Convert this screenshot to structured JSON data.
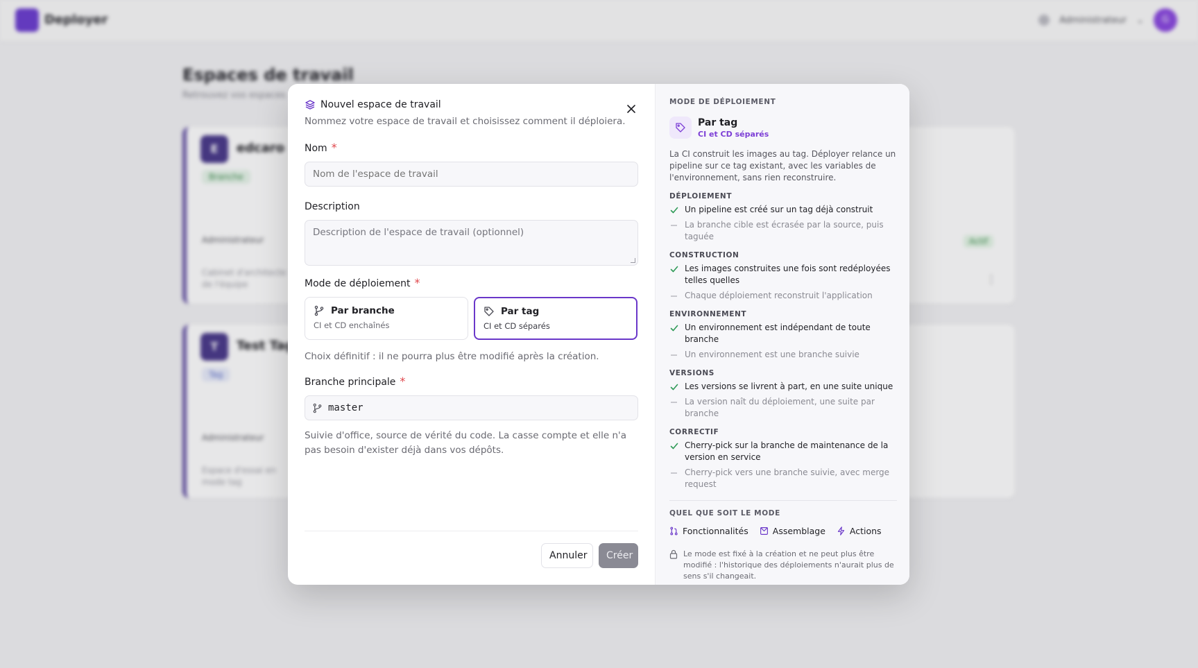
{
  "app": {
    "brand": "Deployer",
    "user_name": "Administrateur",
    "avatar_initial": "G"
  },
  "background": {
    "title": "Espaces de travail",
    "subtitle": "Retrouvez vos espaces",
    "cards": [
      {
        "initial": "E",
        "name": "edcaro",
        "chip": "Branche",
        "owner": "Administrateur",
        "desc": "Cabinet d'architecte de l'équipe",
        "status": "Actif"
      },
      {
        "initial": "T",
        "name": "Test Tag",
        "chip": "Tag",
        "owner": "Administrateur",
        "desc": "Espace d'essai en mode tag"
      }
    ]
  },
  "modal": {
    "title": "Nouvel espace de travail",
    "subtitle": "Nommez votre espace de travail et choisissez comment il déploiera.",
    "name_label": "Nom",
    "name_placeholder": "Nom de l'espace de travail",
    "name_value": "",
    "description_label": "Description",
    "description_placeholder": "Description de l'espace de travail (optionnel)",
    "description_value": "",
    "mode_label": "Mode de déploiement",
    "modes": [
      {
        "label": "Par branche",
        "sub": "CI et CD enchaînés",
        "selected": false,
        "icon": "git-branch-icon"
      },
      {
        "label": "Par tag",
        "sub": "CI et CD séparés",
        "selected": true,
        "icon": "tag-icon"
      }
    ],
    "mode_hint": "Choix définitif : il ne pourra plus être modifié après la création.",
    "branch_label": "Branche principale",
    "branch_value": "master",
    "branch_hint": "Suivie d'office, source de vérité du code. La casse compte et elle n'a pas besoin d'exister déjà dans vos dépôts.",
    "cancel_label": "Annuler",
    "create_label": "Créer",
    "required_mark": "*"
  },
  "panel": {
    "heading": "MODE DE DÉPLOIEMENT",
    "mode_name": "Par tag",
    "mode_sub": "CI et CD séparés",
    "description": "La CI construit les images au tag. Déployer relance un pipeline sur ce tag existant, avec les variables de l'environnement, sans rien reconstruire.",
    "sections": [
      {
        "title": "DÉPLOIEMENT",
        "yes": "Un pipeline est créé sur un tag déjà construit",
        "no": "La branche cible est écrasée par la source, puis taguée"
      },
      {
        "title": "CONSTRUCTION",
        "yes": "Les images construites une fois sont redéployées telles quelles",
        "no": "Chaque déploiement reconstruit l'application"
      },
      {
        "title": "ENVIRONNEMENT",
        "yes": "Un environnement est indépendant de toute branche",
        "no": "Un environnement est une branche suivie"
      },
      {
        "title": "VERSIONS",
        "yes": "Les versions se livrent à part, en une suite unique",
        "no": "La version naît du déploiement, une suite par branche"
      },
      {
        "title": "CORRECTIF",
        "yes": "Cherry-pick sur la branche de maintenance de la version en service",
        "no": "Cherry-pick vers une branche suivie, avec merge request"
      }
    ],
    "any_mode_title": "QUEL QUE SOIT LE MODE",
    "features": [
      {
        "label": "Fonctionnalités",
        "icon": "pull-request-icon"
      },
      {
        "label": "Assemblage",
        "icon": "assembly-icon"
      },
      {
        "label": "Actions",
        "icon": "lightning-icon"
      }
    ],
    "lock_note": "Le mode est fixé à la création et ne peut plus être modifié : l'historique des déploiements n'aurait plus de sens s'il changeait.",
    "accent_color": "#6a37c9"
  }
}
